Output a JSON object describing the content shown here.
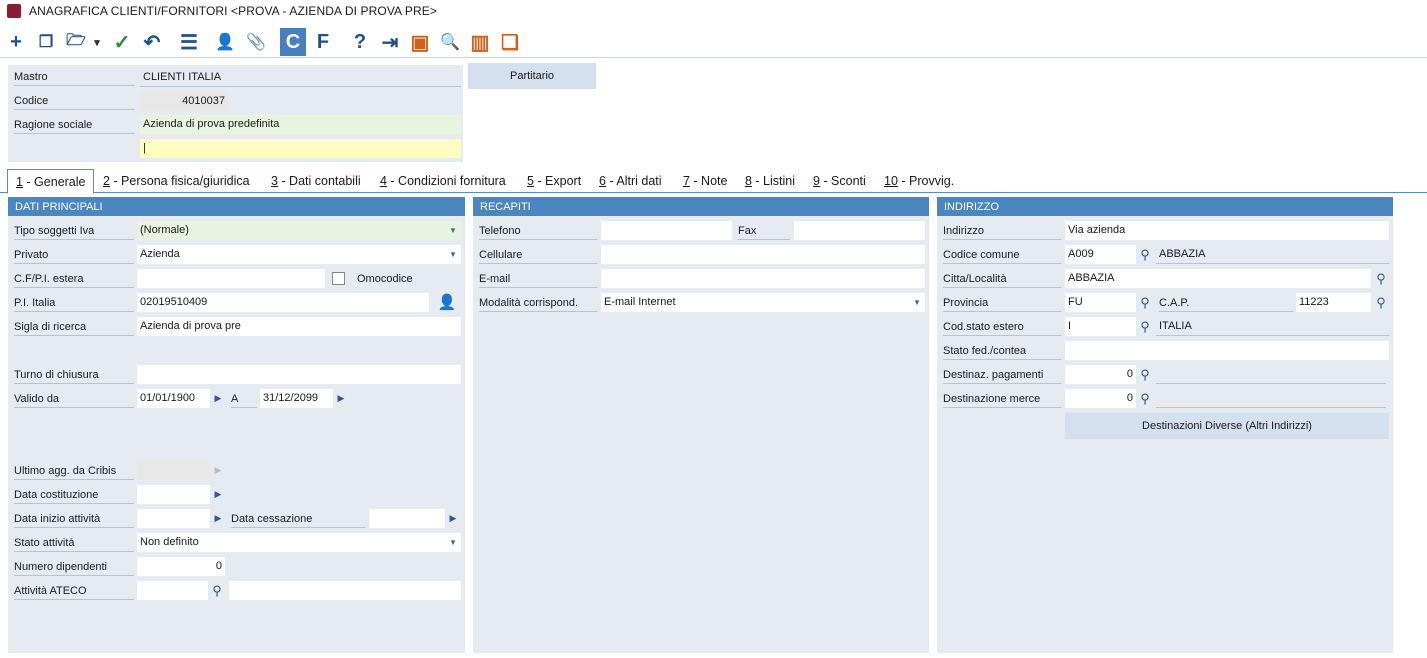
{
  "window": {
    "title": "ANAGRAFICA CLIENTI/FORNITORI <PROVA - AZIENDA DI PROVA PRE>"
  },
  "toolbar": {
    "items": [
      {
        "name": "add-icon",
        "glyph": "+"
      },
      {
        "name": "copy-icon",
        "glyph": "❐"
      },
      {
        "name": "open-folder-icon",
        "glyph": "🗁"
      },
      {
        "name": "chevron-down-icon",
        "glyph": "▾"
      },
      {
        "name": "confirm-icon",
        "glyph": "✓"
      },
      {
        "name": "undo-icon",
        "glyph": "↶"
      },
      {
        "name": "menu-icon",
        "glyph": "☰"
      },
      {
        "name": "contacts-icon",
        "glyph": "👤"
      },
      {
        "name": "attach-icon",
        "glyph": "📎"
      },
      {
        "name": "clients-toggle-c",
        "glyph": "C"
      },
      {
        "name": "suppliers-toggle-f",
        "glyph": "F"
      },
      {
        "name": "help-icon",
        "glyph": "?"
      },
      {
        "name": "exit-icon",
        "glyph": "⇥"
      },
      {
        "name": "briefcase-icon",
        "glyph": "▣"
      },
      {
        "name": "search-doc-icon",
        "glyph": "🔍"
      },
      {
        "name": "barcode-icon",
        "glyph": "▥"
      },
      {
        "name": "documents-icon",
        "glyph": "❏"
      }
    ]
  },
  "header": {
    "mastro_label": "Mastro",
    "mastro_value": "CLIENTI ITALIA",
    "codice_label": "Codice",
    "codice_value": "4010037",
    "ragione_label": "Ragione sociale",
    "ragione_value": "Azienda di prova predefinita",
    "ragione2_value": "|",
    "partitario_label": "Partitario"
  },
  "tabs": [
    {
      "key": "1",
      "label": " - Generale"
    },
    {
      "key": "2",
      "label": " - Persona fisica/giuridica"
    },
    {
      "key": "3",
      "label": " - Dati contabili"
    },
    {
      "key": "4",
      "label": " - Condizioni fornitura"
    },
    {
      "key": "5",
      "label": " - Export"
    },
    {
      "key": "6",
      "label": " - Altri dati"
    },
    {
      "key": "7",
      "label": " - Note"
    },
    {
      "key": "8",
      "label": " - Listini"
    },
    {
      "key": "9",
      "label": " - Sconti"
    },
    {
      "key": "10",
      "label": " - Provvig."
    }
  ],
  "dati": {
    "title": "DATI PRINCIPALI",
    "tipo_iva_label": "Tipo soggetti Iva",
    "tipo_iva_value": "(Normale)",
    "privato_label": "Privato",
    "privato_value": "Azienda",
    "cf_label": "C.F/P.I. estera",
    "cf_value": "",
    "omocodice_label": "Omocodice",
    "pi_label": "P.I. Italia",
    "pi_value": "02019510409",
    "sigla_label": "Sigla di ricerca",
    "sigla_value": "Azienda di prova pre",
    "turno_label": "Turno di chiusura",
    "turno_value": "",
    "valido_label": "Valido da",
    "valido_da": "01/01/1900",
    "a_label": "A",
    "valido_a": "31/12/2099",
    "cribis_label": "Ultimo agg. da Cribis",
    "costituzione_label": "Data costituzione",
    "inizio_label": "Data inizio attività",
    "cessazione_label": "Data cessazione",
    "stato_label": "Stato attività",
    "stato_value": "Non definito",
    "dipendenti_label": "Numero dipendenti",
    "dipendenti_value": "0",
    "ateco_label": "Attività ATECO"
  },
  "recapiti": {
    "title": "RECAPITI",
    "telefono_label": "Telefono",
    "fax_label": "Fax",
    "cellulare_label": "Cellulare",
    "email_label": "E-mail",
    "modalita_label": "Modalità corrispond.",
    "modalita_value": "E-mail Internet"
  },
  "indirizzo": {
    "title": "INDIRIZZO",
    "indirizzo_label": "Indirizzo",
    "indirizzo_value": "Via azienda",
    "comune_label": "Codice comune",
    "comune_code": "A009",
    "comune_name": "ABBAZIA",
    "citta_label": "Citta/Località",
    "citta_value": "ABBAZIA",
    "provincia_label": "Provincia",
    "provincia_value": "FU",
    "cap_label": "C.A.P.",
    "cap_value": "11223",
    "stato_estero_label": "Cod.stato estero",
    "stato_estero_code": "I",
    "stato_estero_name": "ITALIA",
    "stato_fed_label": "Stato fed./contea",
    "pagamenti_label": "Destinaz. pagamenti",
    "pagamenti_value": "0",
    "merce_label": "Destinazione merce",
    "merce_value": "0",
    "dest_button": "Destinazioni Diverse (Altri Indirizzi)"
  }
}
